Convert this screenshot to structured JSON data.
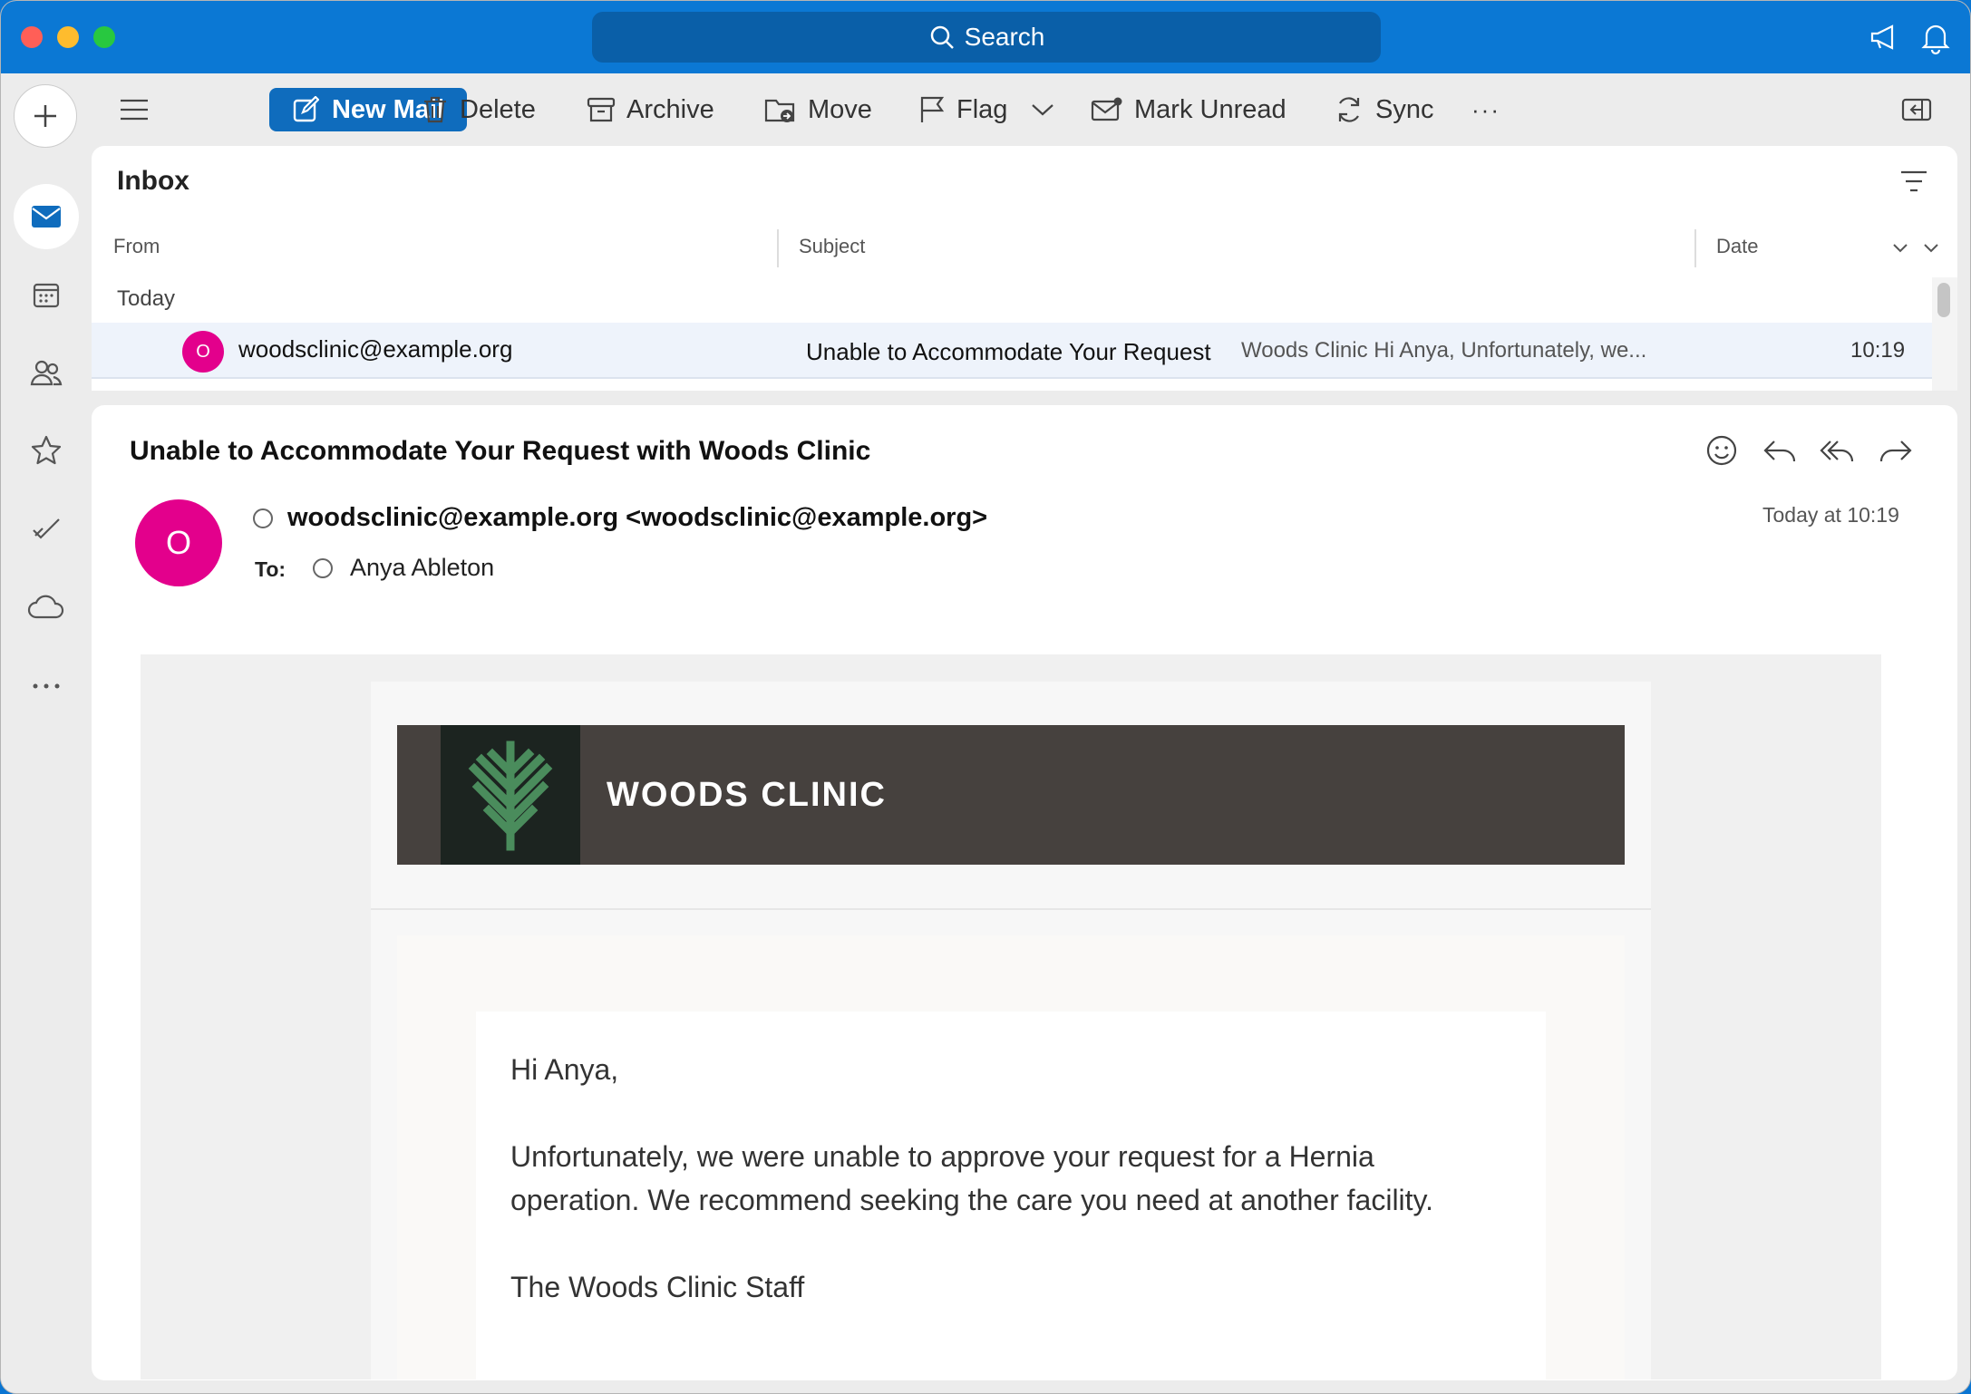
{
  "window": {
    "search_placeholder": "Search"
  },
  "toolbar": {
    "new_mail": "New Mail",
    "delete": "Delete",
    "archive": "Archive",
    "move": "Move",
    "flag": "Flag",
    "mark_unread": "Mark Unread",
    "sync": "Sync",
    "more": "···"
  },
  "inbox": {
    "title": "Inbox",
    "columns": {
      "from": "From",
      "subject": "Subject",
      "date": "Date"
    },
    "group": "Today",
    "rows": [
      {
        "avatar": "O",
        "from": "woodsclinic@example.org",
        "subject": "Unable to Accommodate Your Request",
        "preview": "Woods Clinic Hi Anya, Unfortunately, we...",
        "time": "10:19"
      }
    ]
  },
  "message": {
    "subject": "Unable to Accommodate Your Request with Woods Clinic",
    "avatar": "O",
    "sender": "woodsclinic@example.org <woodsclinic@example.org>",
    "to_label": "To:",
    "to_name": "Anya  Ableton",
    "date": "Today at 10:19",
    "brand": "WOODS CLINIC",
    "greeting": "Hi Anya,",
    "body": "Unfortunately, we were unable to approve your request for a Hernia operation. We recommend seeking the care you need at another facility.",
    "signoff": "The Woods Clinic Staff"
  },
  "colors": {
    "titlebar": "#0b78d4",
    "accent": "#0f6cbd",
    "avatar": "#e3008c",
    "banner": "#46413e",
    "logo_leaf": "#4a8c5c"
  }
}
